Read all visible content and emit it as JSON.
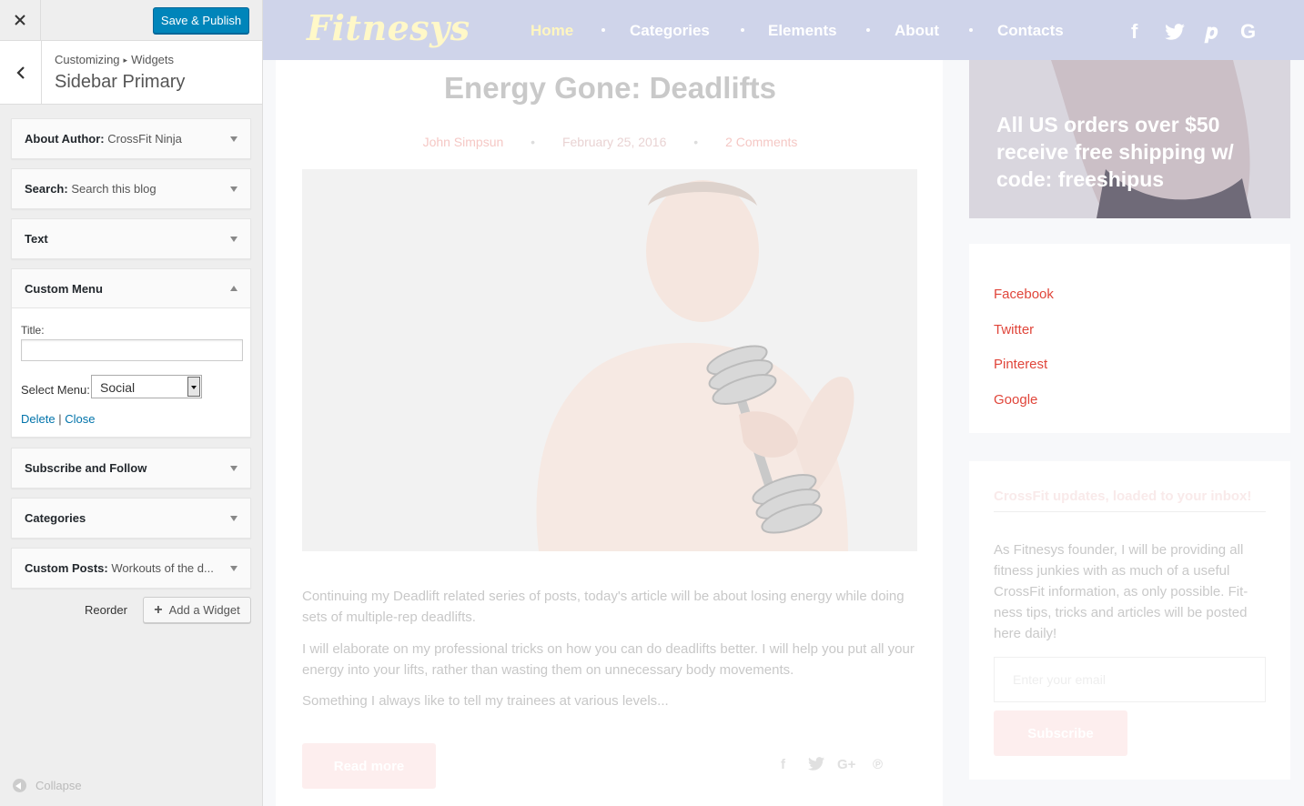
{
  "customizer": {
    "save_label": "Save & Publish",
    "close_icon": "close-icon",
    "breadcrumb": {
      "first": "Customizing",
      "separator": "▸",
      "second": "Widgets"
    },
    "section_title": "Sidebar Primary",
    "widgets": [
      {
        "label": "About Author:",
        "sub": "CrossFit Ninja"
      },
      {
        "label": "Search:",
        "sub": "Search this blog"
      },
      {
        "label": "Text",
        "sub": ""
      },
      {
        "label": "Custom Menu",
        "sub": ""
      },
      {
        "label": "Subscribe and Follow",
        "sub": ""
      },
      {
        "label": "Categories",
        "sub": ""
      },
      {
        "label": "Custom Posts:",
        "sub": "Workouts of the d..."
      }
    ],
    "custom_menu": {
      "title_label": "Title:",
      "title_value": "",
      "select_label": "Select Menu:",
      "select_value": "Social",
      "delete_label": "Delete",
      "divider": "|",
      "close_label": "Close"
    },
    "reorder_label": "Reorder",
    "add_widget_label": "Add a Widget",
    "collapse_label": "Collapse"
  },
  "site": {
    "logo": "Fitnesys",
    "nav": [
      "Home",
      "Categories",
      "Elements",
      "About",
      "Contacts"
    ],
    "social_icons": [
      "f",
      "twitter-bird",
      "p",
      "G"
    ],
    "colors": {
      "header": "#cfd4ea",
      "accent": "#e0453a",
      "wp_blue": "#0085ba"
    }
  },
  "post": {
    "title": "Energy Gone: Deadlifts",
    "author": "John Simpsun",
    "date": "February 25, 2016",
    "comments": "2 Comments",
    "paragraphs": [
      "Continuing my Deadlift related series of posts, today's article will be about losing energy while doing sets of multiple-rep deadlifts.",
      "I will elaborate on my professional tricks on how you can do deadlifts better. I will help you put all your energy into your lifts, rather than wasting them on unnecessary body movements.",
      "Something I always like to tell my trainees at various levels..."
    ],
    "read_more": "Read more",
    "share_icons": [
      "f",
      "twitter",
      "G+",
      "p"
    ]
  },
  "sidebar": {
    "promo_text": "All US orders over $50 receive free shipping w/ code: freeshipus",
    "social_links": [
      "Facebook",
      "Twitter",
      "Pinterest",
      "Google"
    ],
    "subscribe": {
      "title": "CrossFit updates, loaded to your inbox!",
      "text": "As Fitnesys founder, I will be providing all fitness junkies with as much of a useful CrossFit information, as only possible. Fit-ness tips, tricks and articles will be posted here daily!",
      "placeholder": "Enter your email",
      "button": "Subscribe"
    }
  }
}
